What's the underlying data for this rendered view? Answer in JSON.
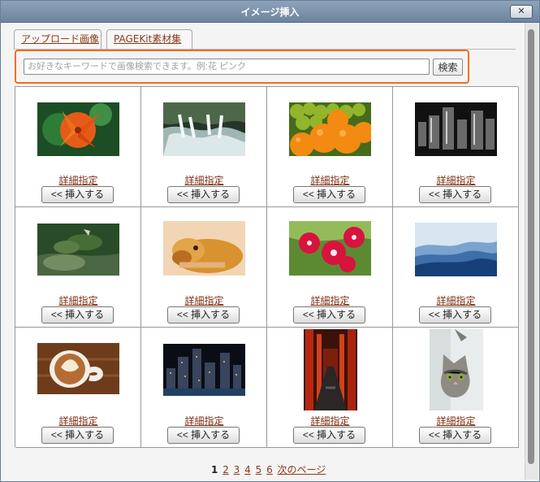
{
  "window": {
    "title": "イメージ挿入",
    "close_label": "✕"
  },
  "tabs": [
    {
      "label": "アップロード画像"
    },
    {
      "label": "PAGEKit素材集"
    }
  ],
  "search": {
    "placeholder": "お好きなキーワードで画像検索できます。例:花 ピンク",
    "button_label": "検索"
  },
  "gallery": {
    "detail_label": "詳細指定",
    "insert_label": "<< 挿入する",
    "items": [
      {
        "subject": "orange-lily"
      },
      {
        "subject": "waterfall"
      },
      {
        "subject": "oranges-grapes"
      },
      {
        "subject": "city-bw"
      },
      {
        "subject": "japanese-garden"
      },
      {
        "subject": "sleeping-dog"
      },
      {
        "subject": "red-flowers"
      },
      {
        "subject": "blue-mountains"
      },
      {
        "subject": "latte"
      },
      {
        "subject": "city-night"
      },
      {
        "subject": "torii-path"
      },
      {
        "subject": "cat"
      }
    ]
  },
  "pagination": {
    "current": "1",
    "pages": [
      "2",
      "3",
      "4",
      "5",
      "6"
    ],
    "next_label": "次のページ"
  },
  "colors": {
    "highlight": "#f26d19",
    "link": "#8a3a18",
    "titlebar": "#7d91a9"
  }
}
